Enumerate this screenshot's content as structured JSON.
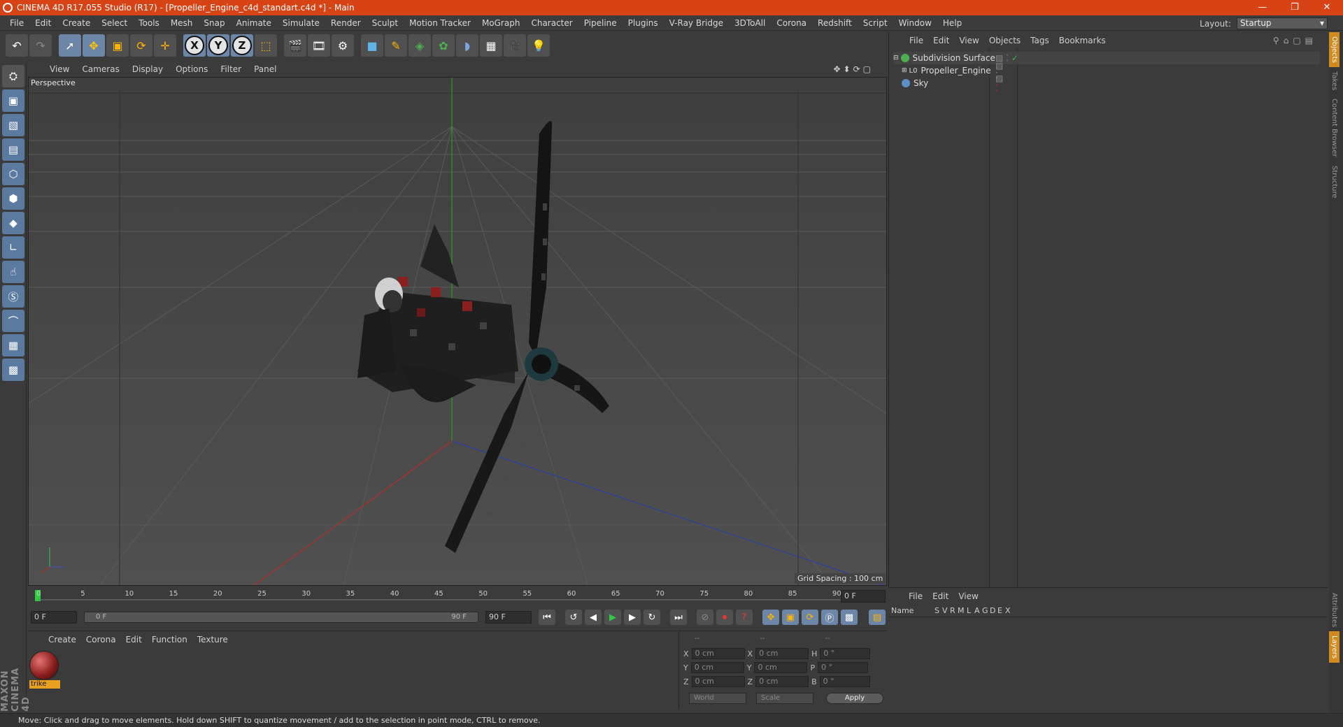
{
  "window": {
    "title": "CINEMA 4D R17.055 Studio (R17) - [Propeller_Engine_c4d_standart.c4d *] - Main",
    "controls": [
      "—",
      "❐",
      "✕"
    ]
  },
  "menu": [
    "File",
    "Edit",
    "Create",
    "Select",
    "Tools",
    "Mesh",
    "Snap",
    "Animate",
    "Simulate",
    "Render",
    "Sculpt",
    "Motion Tracker",
    "MoGraph",
    "Character",
    "Pipeline",
    "Plugins",
    "V-Ray Bridge",
    "3DToAll",
    "Corona",
    "Redshift",
    "Script",
    "Window",
    "Help"
  ],
  "layout": {
    "label": "Layout:",
    "value": "Startup"
  },
  "viewport": {
    "menu": [
      "View",
      "Cameras",
      "Display",
      "Options",
      "Filter",
      "Panel"
    ],
    "label": "Perspective",
    "grid_spacing": "Grid Spacing : 100 cm",
    "axes": {
      "x": "X",
      "y": "Y",
      "z": "Z"
    }
  },
  "objects_panel": {
    "menu": [
      "File",
      "Edit",
      "View",
      "Objects",
      "Tags",
      "Bookmarks"
    ],
    "items": [
      {
        "name": "Subdivision Surface",
        "color": "#4caf50"
      },
      {
        "name": "Propeller_Engine",
        "color": "#dcdcdc"
      },
      {
        "name": "Sky",
        "color": "#5d8fc7"
      }
    ]
  },
  "side_tabs": [
    "Objects",
    "Takes",
    "Content Browser",
    "Structure"
  ],
  "attr_tabs": [
    "Attributes",
    "Layers"
  ],
  "timeline": {
    "ticks": [
      "0",
      "5",
      "10",
      "15",
      "20",
      "25",
      "30",
      "35",
      "40",
      "45",
      "50",
      "55",
      "60",
      "65",
      "70",
      "75",
      "80",
      "85",
      "90"
    ],
    "end_field": "0 F",
    "start_field": "0 F",
    "range_left": "0 F",
    "range_right": "90 F",
    "max_field": "90 F"
  },
  "material_panel": {
    "menu": [
      "Create",
      "Corona",
      "Edit",
      "Function",
      "Texture"
    ],
    "material_name": "trike"
  },
  "coord_panel": {
    "headers": [
      "--",
      "--",
      "--"
    ],
    "rows": [
      {
        "a": "X",
        "av": "0 cm",
        "b": "X",
        "bv": "0 cm",
        "c": "H",
        "cv": "0 °"
      },
      {
        "a": "Y",
        "av": "0 cm",
        "b": "Y",
        "bv": "0 cm",
        "c": "P",
        "cv": "0 °"
      },
      {
        "a": "Z",
        "av": "0 cm",
        "b": "Z",
        "bv": "0 cm",
        "c": "B",
        "cv": "0 °"
      }
    ],
    "world": "World",
    "scale": "Scale",
    "apply": "Apply"
  },
  "attr_panel": {
    "menu": [
      "File",
      "Edit",
      "View"
    ],
    "columns": [
      "Name",
      "S",
      "V",
      "R",
      "M",
      "L",
      "A",
      "G",
      "D",
      "E",
      "X"
    ]
  },
  "brand": "MAXON CINEMA 4D",
  "status": "Move: Click and drag to move elements. Hold down SHIFT to quantize movement / add to the selection in point mode, CTRL to remove."
}
